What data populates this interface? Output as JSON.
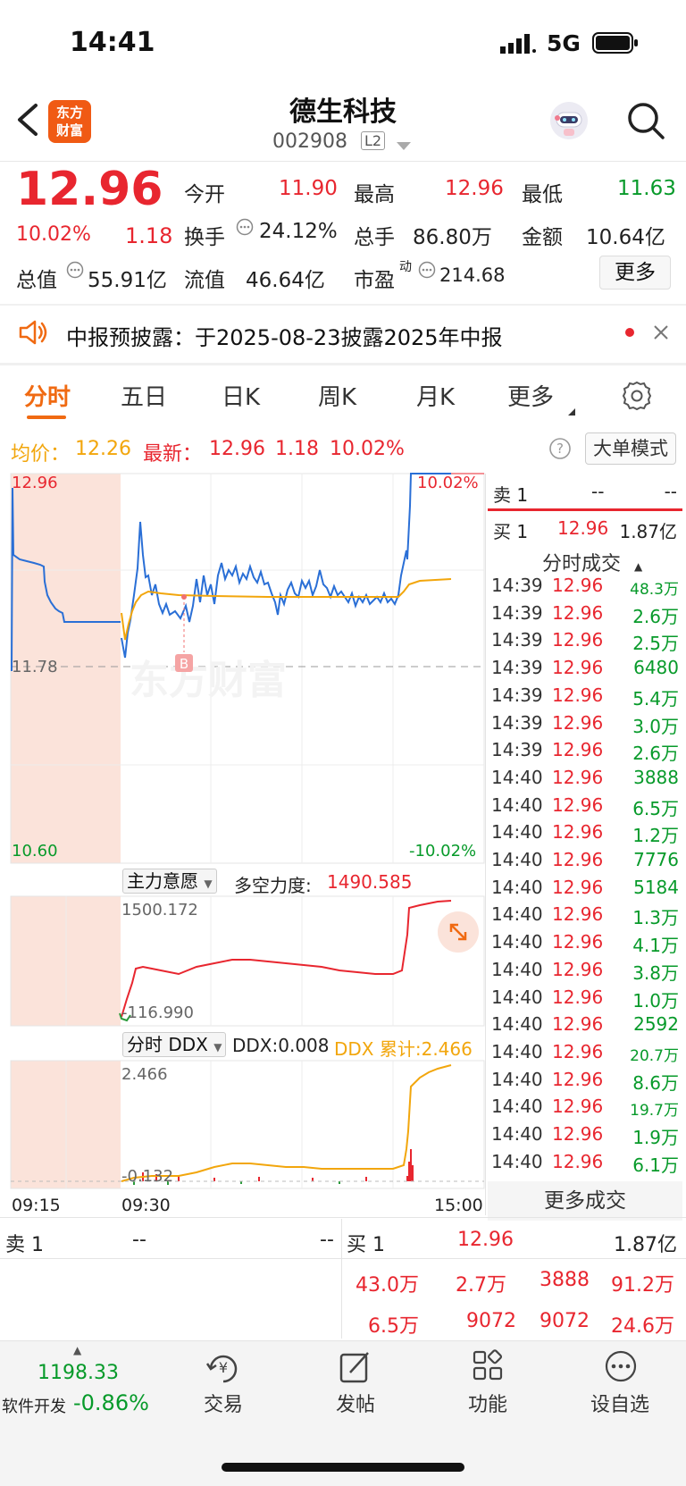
{
  "status_bar": {
    "time": "14:41",
    "network": "5G"
  },
  "header": {
    "back_icon": "chevron-left-icon",
    "brand_logo": [
      "东方",
      "财富"
    ],
    "title": "德生科技",
    "code": "002908",
    "level_badge": "L2",
    "avatar_icon": "robot-avatar-icon",
    "search_icon": "search-icon"
  },
  "quote": {
    "price": "12.96",
    "change_pct": "10.02%",
    "change": "1.18",
    "open_label": "今开",
    "open": "11.90",
    "high_label": "最高",
    "high": "12.96",
    "low_label": "最低",
    "low": "11.63",
    "turnover_label": "换手",
    "turnover": "24.12%",
    "volume_label": "总手",
    "volume": "86.80万",
    "amount_label": "金额",
    "amount": "10.64亿",
    "mktcap_label": "总值",
    "mktcap": "55.91亿",
    "float_label": "流值",
    "float_cap": "46.64亿",
    "pe_label": "市盈",
    "pe_sup": "动",
    "pe": "214.68",
    "more_label": "更多"
  },
  "notice": {
    "text": "中报预披露：于2025-08-23披露2025年中报",
    "speaker_icon": "speaker-icon",
    "close_icon": "close-icon",
    "dot_color": "#e8262f"
  },
  "tabs": [
    "分时",
    "五日",
    "日K",
    "周K",
    "月K",
    "更多"
  ],
  "active_tab": "分时",
  "info_line": {
    "avg_label": "均价：",
    "avg": "12.26",
    "latest_label": "最新：",
    "latest": "12.96",
    "latest_change": "1.18",
    "latest_pct": "10.02%",
    "mode_button": "大单模式"
  },
  "main_chart": {
    "y_top": "12.96",
    "y_mid": "11.78",
    "y_bottom": "10.60",
    "pct_top": "10.02%",
    "pct_bottom": "-10.02%",
    "buy_marker": "B",
    "watermark": "东方财富"
  },
  "indicator1": {
    "name": "主力意愿",
    "label": "多空力度:",
    "value": "1490.585",
    "max": "1500.172",
    "min": "-116.990"
  },
  "indicator2": {
    "name": "分时 DDX",
    "ddx_label": "DDX:0.008",
    "cum_label": "DDX 累计:2.466",
    "max": "2.466",
    "min": "-0.132"
  },
  "time_axis": [
    "09:15",
    "09:30",
    "15:00"
  ],
  "level_book": {
    "sell1_label": "卖 1",
    "sell1_price": "--",
    "sell1_vol": "--",
    "buy1_label": "买 1",
    "buy1_price": "12.96",
    "buy1_vol": "1.87亿"
  },
  "trades_header": "分时成交",
  "trades": [
    {
      "time": "14:39",
      "price": "12.96",
      "vol": "48.3万"
    },
    {
      "time": "14:39",
      "price": "12.96",
      "vol": "2.6万"
    },
    {
      "time": "14:39",
      "price": "12.96",
      "vol": "2.5万"
    },
    {
      "time": "14:39",
      "price": "12.96",
      "vol": "6480"
    },
    {
      "time": "14:39",
      "price": "12.96",
      "vol": "5.4万"
    },
    {
      "time": "14:39",
      "price": "12.96",
      "vol": "3.0万"
    },
    {
      "time": "14:39",
      "price": "12.96",
      "vol": "2.6万"
    },
    {
      "time": "14:40",
      "price": "12.96",
      "vol": "3888"
    },
    {
      "time": "14:40",
      "price": "12.96",
      "vol": "6.5万"
    },
    {
      "time": "14:40",
      "price": "12.96",
      "vol": "1.2万"
    },
    {
      "time": "14:40",
      "price": "12.96",
      "vol": "7776"
    },
    {
      "time": "14:40",
      "price": "12.96",
      "vol": "5184"
    },
    {
      "time": "14:40",
      "price": "12.96",
      "vol": "1.3万"
    },
    {
      "time": "14:40",
      "price": "12.96",
      "vol": "4.1万"
    },
    {
      "time": "14:40",
      "price": "12.96",
      "vol": "3.8万"
    },
    {
      "time": "14:40",
      "price": "12.96",
      "vol": "1.0万"
    },
    {
      "time": "14:40",
      "price": "12.96",
      "vol": "2592"
    },
    {
      "time": "14:40",
      "price": "12.96",
      "vol": "20.7万"
    },
    {
      "time": "14:40",
      "price": "12.96",
      "vol": "8.6万"
    },
    {
      "time": "14:40",
      "price": "12.96",
      "vol": "19.7万"
    },
    {
      "time": "14:40",
      "price": "12.96",
      "vol": "1.9万"
    },
    {
      "time": "14:40",
      "price": "12.96",
      "vol": "6.1万"
    }
  ],
  "more_trades": "更多成交",
  "order_book": {
    "sell1_label": "卖 1",
    "sell1_price": "--",
    "sell1_vol": "--",
    "buy1_label": "买 1",
    "buy1_price": "12.96",
    "buy1_vol": "1.87亿",
    "rows": [
      [
        "43.0万",
        "2.7万",
        "3888",
        "91.2万"
      ],
      [
        "6.5万",
        "9072",
        "9072",
        "24.6万"
      ]
    ]
  },
  "bottom_bar": {
    "index_value": "1198.33",
    "index_name": "软件开发",
    "index_change": "-0.86%",
    "items": [
      {
        "label": "交易",
        "icon": "yuan-exchange-icon"
      },
      {
        "label": "发帖",
        "icon": "edit-icon"
      },
      {
        "label": "功能",
        "icon": "grid-icon"
      },
      {
        "label": "设自选",
        "icon": "more-dots-icon"
      }
    ]
  },
  "colors": {
    "up": "#e8262f",
    "down": "#079a2a",
    "avg_line": "#f2a60c",
    "price_line": "#2a6fd6",
    "accent": "#f06a12"
  }
}
